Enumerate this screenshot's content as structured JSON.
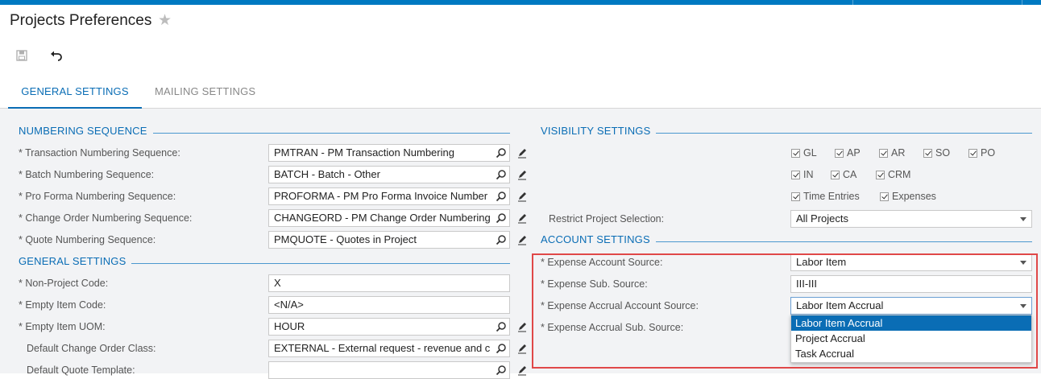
{
  "page": {
    "title": "Projects Preferences"
  },
  "tabs": [
    {
      "label": "GENERAL SETTINGS"
    },
    {
      "label": "MAILING SETTINGS"
    }
  ],
  "numbering": {
    "header": "NUMBERING SEQUENCE",
    "rows": [
      {
        "label": "* Transaction Numbering Sequence:",
        "value": "PMTRAN - PM Transaction Numbering"
      },
      {
        "label": "* Batch Numbering Sequence:",
        "value": "BATCH - Batch - Other"
      },
      {
        "label": "* Pro Forma Numbering Sequence:",
        "value": "PROFORMA - PM Pro Forma Invoice Number"
      },
      {
        "label": "* Change Order Numbering Sequence:",
        "value": "CHANGEORD - PM Change Order Numbering"
      },
      {
        "label": "* Quote Numbering Sequence:",
        "value": "PMQUOTE - Quotes in Project"
      }
    ]
  },
  "general": {
    "header": "GENERAL SETTINGS",
    "rows": [
      {
        "label": "* Non-Project Code:",
        "value": "X"
      },
      {
        "label": "* Empty Item Code:",
        "value": "<N/A>"
      },
      {
        "label": "* Empty Item UOM:",
        "value": "HOUR"
      },
      {
        "label": "Default Change Order Class:",
        "value": "EXTERNAL - External request - revenue and cost"
      },
      {
        "label": "Default Quote Template:",
        "value": ""
      }
    ]
  },
  "visibility": {
    "header": "VISIBILITY SETTINGS",
    "modules": [
      "GL",
      "AP",
      "AR",
      "SO",
      "PO",
      "IN",
      "CA",
      "CRM",
      "Time Entries",
      "Expenses"
    ],
    "restrict_label": "Restrict Project Selection:",
    "restrict_value": "All Projects"
  },
  "account": {
    "header": "ACCOUNT SETTINGS",
    "expense_account_source_label": "* Expense Account Source:",
    "expense_account_source_value": "Labor Item",
    "expense_sub_source_label": "* Expense Sub. Source:",
    "expense_sub_source_value": "III-III",
    "accrual_account_source_label": "* Expense Accrual Account Source:",
    "accrual_account_source_value": "Labor Item Accrual",
    "accrual_sub_source_label": "* Expense Accrual Sub. Source:",
    "dropdown_options": [
      "Labor Item Accrual",
      "Project Accrual",
      "Task Accrual"
    ],
    "dropdown_selected": "Labor Item Accrual"
  },
  "colors": {
    "accent": "#0a6db5",
    "topbar": "#0079c1",
    "highlight": "#e04848",
    "panel": "#f2f3f5"
  },
  "icons": {
    "star": "star-icon",
    "save": "save-icon",
    "undo": "undo-icon",
    "search": "search-icon",
    "edit": "pencil-icon"
  }
}
